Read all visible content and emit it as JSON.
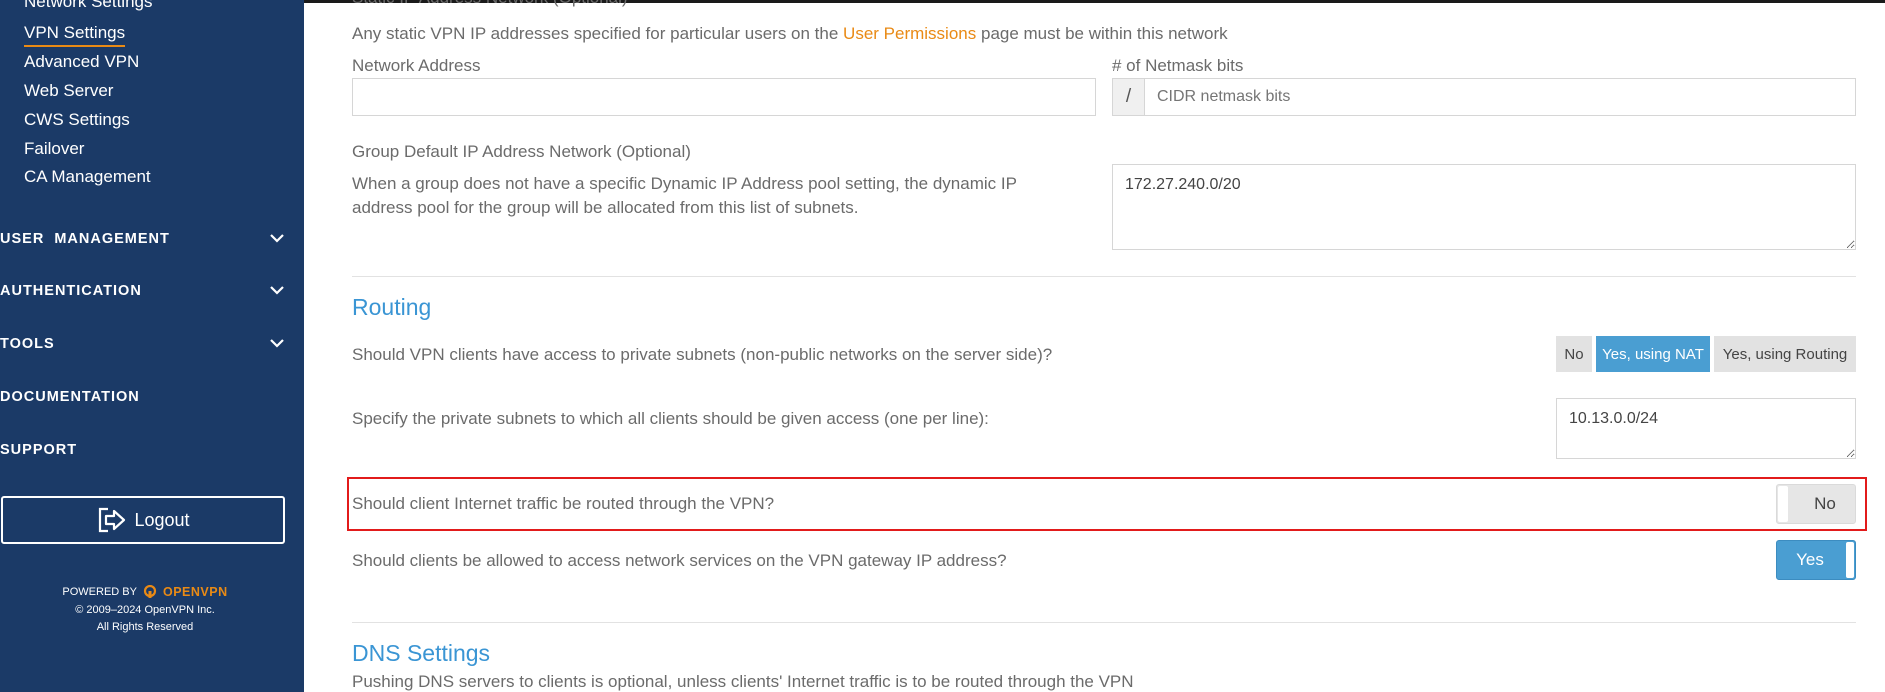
{
  "sidebar": {
    "sub_items": [
      {
        "label": "Network Settings"
      },
      {
        "label": "VPN Settings"
      },
      {
        "label": "Advanced VPN"
      },
      {
        "label": "Web Server"
      },
      {
        "label": "CWS Settings"
      },
      {
        "label": "Failover"
      },
      {
        "label": "CA Management"
      }
    ],
    "sections": [
      {
        "label": "USER  MANAGEMENT"
      },
      {
        "label": "AUTHENTICATION"
      },
      {
        "label": "TOOLS"
      },
      {
        "label": "DOCUMENTATION"
      },
      {
        "label": "SUPPORT"
      }
    ],
    "logout_label": "Logout",
    "footer": {
      "powered_by": "POWERED BY",
      "brand": "OPENVPN",
      "copyright": "© 2009–2024 OpenVPN Inc.",
      "rights": "All Rights Reserved"
    }
  },
  "static_ip": {
    "heading_partial": "Static IP Address Network (Optional)",
    "desc_before": "Any static VPN IP addresses specified for particular users on the",
    "desc_link": "User Permissions",
    "desc_after": "page must be within this network",
    "network_address_label": "Network Address",
    "network_address_value": "",
    "netmask_label": "# of Netmask bits",
    "netmask_addon": "/",
    "netmask_placeholder": "CIDR netmask bits"
  },
  "group_default": {
    "heading": "Group Default IP Address Network (Optional)",
    "desc_line1": "When a group does not have a specific Dynamic IP Address pool setting, the dynamic IP",
    "desc_line2": "address pool for the group will be allocated from this list of subnets.",
    "value": "172.27.240.0/20"
  },
  "routing": {
    "heading": "Routing",
    "private_access_question": "Should VPN clients have access to private subnets (non-public networks on the server side)?",
    "private_access_options": [
      {
        "label": "No",
        "selected": false
      },
      {
        "label": "Yes, using NAT",
        "selected": true
      },
      {
        "label": "Yes, using Routing",
        "selected": false
      }
    ],
    "subnets_label": "Specify the private subnets to which all clients should be given access (one per line):",
    "subnets_value": "10.13.0.0/24",
    "internet_traffic_question": "Should client Internet traffic be routed through the VPN?",
    "internet_traffic_value": "No",
    "gateway_access_question": "Should clients be allowed to access network services on the VPN gateway IP address?",
    "gateway_access_value": "Yes"
  },
  "dns": {
    "heading": "DNS Settings",
    "desc": "Pushing DNS servers to clients is optional, unless clients' Internet traffic is to be routed through the VPN"
  },
  "colors": {
    "sidebar_bg": "#1b3a67",
    "accent_blue": "#4a9ed2",
    "accent_orange": "#e98a15",
    "highlight_red": "#e21b1b"
  }
}
